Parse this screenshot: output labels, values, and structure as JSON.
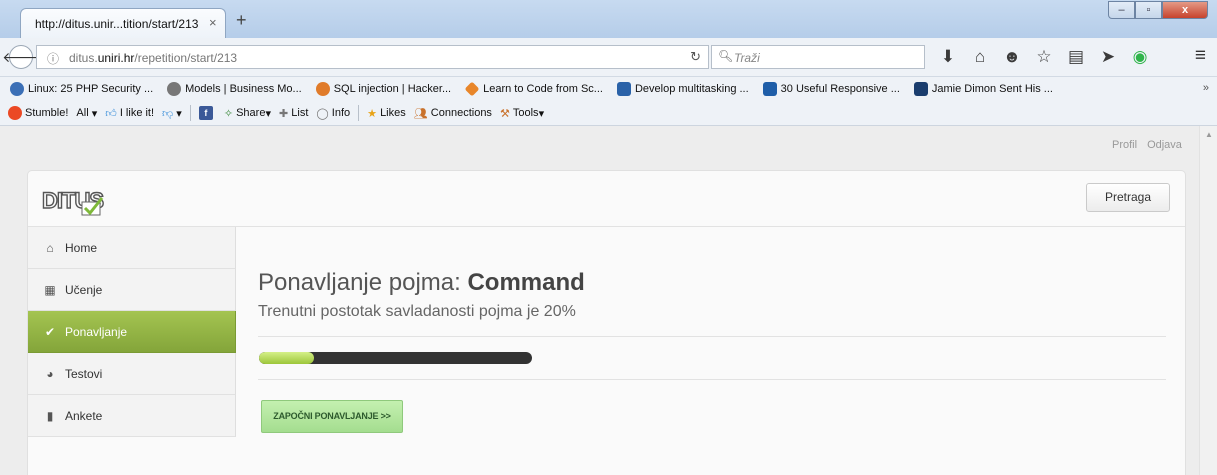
{
  "browser": {
    "tab_title": "http://ditus.unir...tition/start/213",
    "tab_close": "×",
    "new_tab": "+",
    "window_controls": {
      "minimize": "–",
      "maximize": "▫",
      "close": "x"
    },
    "url_prefix": "ditus.",
    "url_domain": "uniri.hr",
    "url_path": "/repetition/start/213",
    "search_placeholder": "Traži",
    "bookmarks": [
      {
        "label": "Linux: 25 PHP Security ...",
        "icon": "#3b6fb6"
      },
      {
        "label": "Models | Business Mo...",
        "icon": "#777777"
      },
      {
        "label": "SQL injection | Hacker...",
        "icon": "#e07b2a"
      },
      {
        "label": "Learn to Code from Sc...",
        "icon": "#e8862a"
      },
      {
        "label": "Develop multitasking ...",
        "icon": "#2a62a8"
      },
      {
        "label": "30 Useful Responsive ...",
        "icon": "#1f5ea8"
      },
      {
        "label": "Jamie Dimon Sent His ...",
        "icon": "#1a3d6e"
      }
    ],
    "bookmarks_more": "»",
    "stumble_toolbar": {
      "stumble": "Stumble!",
      "all": "All",
      "ilike": "I like it!",
      "share": "Share",
      "list": "List",
      "info": "Info",
      "likes": "Likes",
      "connections": "Connections",
      "tools": "Tools"
    }
  },
  "page": {
    "top_links": {
      "profile": "Profil",
      "logout": "Odjava"
    },
    "search_button": "Pretraga",
    "sidebar": [
      {
        "label": "Home",
        "icon": "home-icon",
        "active": false
      },
      {
        "label": "Učenje",
        "icon": "calendar-icon",
        "active": false
      },
      {
        "label": "Ponavljanje",
        "icon": "check-icon",
        "active": true
      },
      {
        "label": "Testovi",
        "icon": "pie-chart-icon",
        "active": false
      },
      {
        "label": "Ankete",
        "icon": "clipboard-icon",
        "active": false
      }
    ],
    "heading_prefix": "Ponavljanje pojma: ",
    "heading_term": "Command",
    "subheading": "Trenutni postotak savladanosti pojma je 20%",
    "progress_percent": 20,
    "start_button": "ZAPOČNI PONAVLJANJE >>",
    "accent_color": "#94b545"
  }
}
